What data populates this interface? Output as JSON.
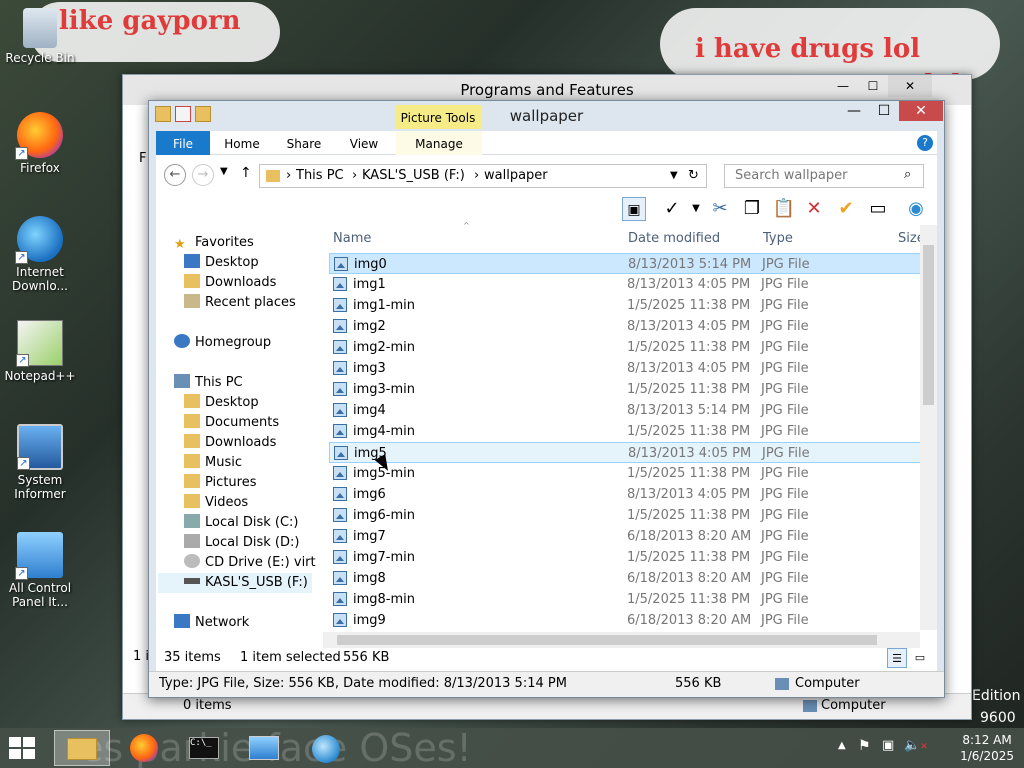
{
  "desktop": {
    "graffiti": [
      "i like gayporn",
      "i have drugs lol",
      "lol"
    ],
    "icons": [
      {
        "label": "Recycle Bin",
        "icon": "recycle-bin-icon"
      },
      {
        "label": "Firefox",
        "icon": "firefox-icon"
      },
      {
        "label": "Internet Downlo...",
        "icon": "internet-download-manager-icon"
      },
      {
        "label": "Notepad++",
        "icon": "notepad-plus-plus-icon"
      },
      {
        "label": "System Informer",
        "icon": "system-informer-icon"
      },
      {
        "label": "All Control Panel It...",
        "icon": "control-panel-icon"
      }
    ],
    "edition_text": "Edition",
    "build_text": "9600"
  },
  "back_window": {
    "title": "Programs and Features",
    "status_items": "0 items",
    "status_location": "Computer",
    "side_fragment_1": "F",
    "side_fragment_2": "1 i"
  },
  "explorer": {
    "title": "wallpaper",
    "context_tab_group": "Picture Tools",
    "tabs": [
      "File",
      "Home",
      "Share",
      "View",
      "Manage"
    ],
    "breadcrumb": [
      "This PC",
      "KASL'S_USB (F:)",
      "wallpaper"
    ],
    "search_placeholder": "Search wallpaper",
    "nav": {
      "favorites": "Favorites",
      "fav_items": [
        "Desktop",
        "Downloads",
        "Recent places"
      ],
      "homegroup": "Homegroup",
      "thispc": "This PC",
      "pc_items": [
        "Desktop",
        "Documents",
        "Downloads",
        "Music",
        "Pictures",
        "Videos",
        "Local Disk (C:)",
        "Local Disk (D:)",
        "CD Drive (E:) virt",
        "KASL'S_USB (F:)"
      ],
      "network": "Network"
    },
    "columns": [
      "Name",
      "Date modified",
      "Type",
      "Size"
    ],
    "files": [
      {
        "name": "img0",
        "date": "8/13/2013 5:14 PM",
        "type": "JPG File"
      },
      {
        "name": "img1",
        "date": "8/13/2013 4:05 PM",
        "type": "JPG File"
      },
      {
        "name": "img1-min",
        "date": "1/5/2025 11:38 PM",
        "type": "JPG File"
      },
      {
        "name": "img2",
        "date": "8/13/2013 4:05 PM",
        "type": "JPG File"
      },
      {
        "name": "img2-min",
        "date": "1/5/2025 11:38 PM",
        "type": "JPG File"
      },
      {
        "name": "img3",
        "date": "8/13/2013 4:05 PM",
        "type": "JPG File"
      },
      {
        "name": "img3-min",
        "date": "1/5/2025 11:38 PM",
        "type": "JPG File"
      },
      {
        "name": "img4",
        "date": "8/13/2013 5:14 PM",
        "type": "JPG File"
      },
      {
        "name": "img4-min",
        "date": "1/5/2025 11:38 PM",
        "type": "JPG File"
      },
      {
        "name": "img5",
        "date": "8/13/2013 4:05 PM",
        "type": "JPG File"
      },
      {
        "name": "img5-min",
        "date": "1/5/2025 11:38 PM",
        "type": "JPG File"
      },
      {
        "name": "img6",
        "date": "8/13/2013 4:05 PM",
        "type": "JPG File"
      },
      {
        "name": "img6-min",
        "date": "1/5/2025 11:38 PM",
        "type": "JPG File"
      },
      {
        "name": "img7",
        "date": "6/18/2013 8:20 AM",
        "type": "JPG File"
      },
      {
        "name": "img7-min",
        "date": "1/5/2025 11:38 PM",
        "type": "JPG File"
      },
      {
        "name": "img8",
        "date": "6/18/2013 8:20 AM",
        "type": "JPG File"
      },
      {
        "name": "img8-min",
        "date": "1/5/2025 11:38 PM",
        "type": "JPG File"
      },
      {
        "name": "img9",
        "date": "6/18/2013 8:20 AM",
        "type": "JPG File"
      }
    ],
    "status": {
      "count": "35 items",
      "selection": "1 item selected",
      "size": "556 KB"
    },
    "details_bar": {
      "text": "Type: JPG File, Size: 556 KB, Date modified: 8/13/2013 5:14 PM",
      "size": "556 KB",
      "location": "Computer"
    }
  },
  "taskbar": {
    "time": "8:12 AM",
    "date": "1/6/2025",
    "background_text": "es parkie face OSes!"
  }
}
